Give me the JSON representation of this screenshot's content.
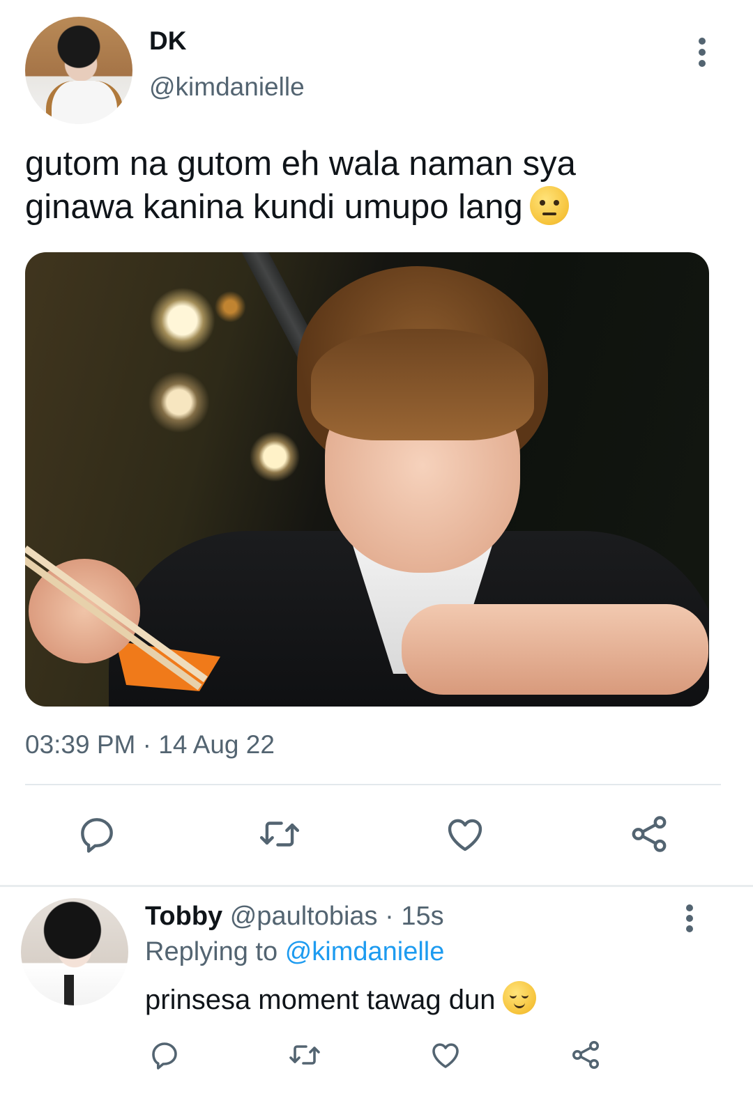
{
  "tweet": {
    "display_name": "DK",
    "handle": "@kimdanielle",
    "text_line1": "gutom na gutom eh wala naman sya",
    "text_line2": "ginawa kanina kundi umupo lang",
    "emoji": "face-with-raised-eyebrow",
    "timestamp": "03:39 PM · 14 Aug 22",
    "actions": [
      "reply-icon",
      "retweet-icon",
      "like-icon",
      "share-icon"
    ]
  },
  "reply": {
    "display_name": "Tobby",
    "handle": "@paultobias",
    "time_ago": "· 15s",
    "replying_label": "Replying to",
    "replying_handle": "@kimdanielle",
    "text": "prinsesa moment tawag dun",
    "emoji": "relieved-face",
    "actions": [
      "reply-icon",
      "retweet-icon",
      "like-icon",
      "share-icon"
    ]
  },
  "colors": {
    "text_primary": "#0f1419",
    "text_secondary": "#536471",
    "link": "#1d9bf0",
    "divider": "#e3e8ec"
  }
}
